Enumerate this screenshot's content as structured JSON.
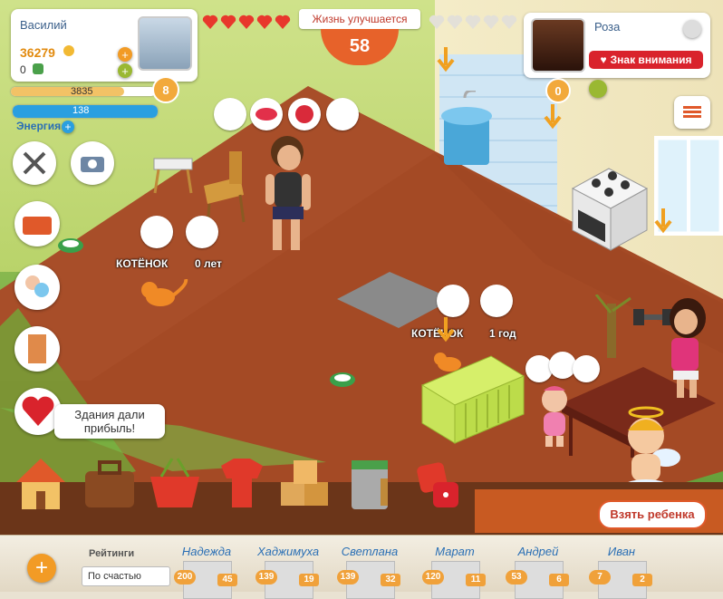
{
  "player": {
    "name": "Василий",
    "coins": "36279",
    "money": "0",
    "xp": "3835",
    "energy": "138",
    "energy_label": "Энергия",
    "level": "8"
  },
  "partner": {
    "name": "Роза",
    "sign_button": "Знак внимания",
    "level": "0"
  },
  "life": {
    "status": "Жизнь улучшается",
    "value": "58"
  },
  "scene_labels": {
    "pet1_name": "КОТЁНОК",
    "pet1_age": "0 лет",
    "pet2_name": "КОТЁНОК",
    "pet2_age": "1 год"
  },
  "notice": {
    "text": "Здания дали прибыль!"
  },
  "adopt_button": "Взять ребенка",
  "ratings": {
    "title": "Рейтинги",
    "filter": "По счастью",
    "friends": [
      {
        "name": "Надежда",
        "level": "200",
        "rank": "45"
      },
      {
        "name": "Хаджимуха",
        "level": "139",
        "rank": "19"
      },
      {
        "name": "Светлана",
        "level": "139",
        "rank": "32"
      },
      {
        "name": "Марат",
        "level": "120",
        "rank": "11"
      },
      {
        "name": "Андрей",
        "level": "53",
        "rank": "6"
      },
      {
        "name": "Иван",
        "level": "7",
        "rank": "2"
      }
    ]
  },
  "colors": {
    "accent": "#f2a93b",
    "energy": "#2a9fe0",
    "danger": "#e23b3b",
    "bottom_bar": "#6b3519"
  }
}
